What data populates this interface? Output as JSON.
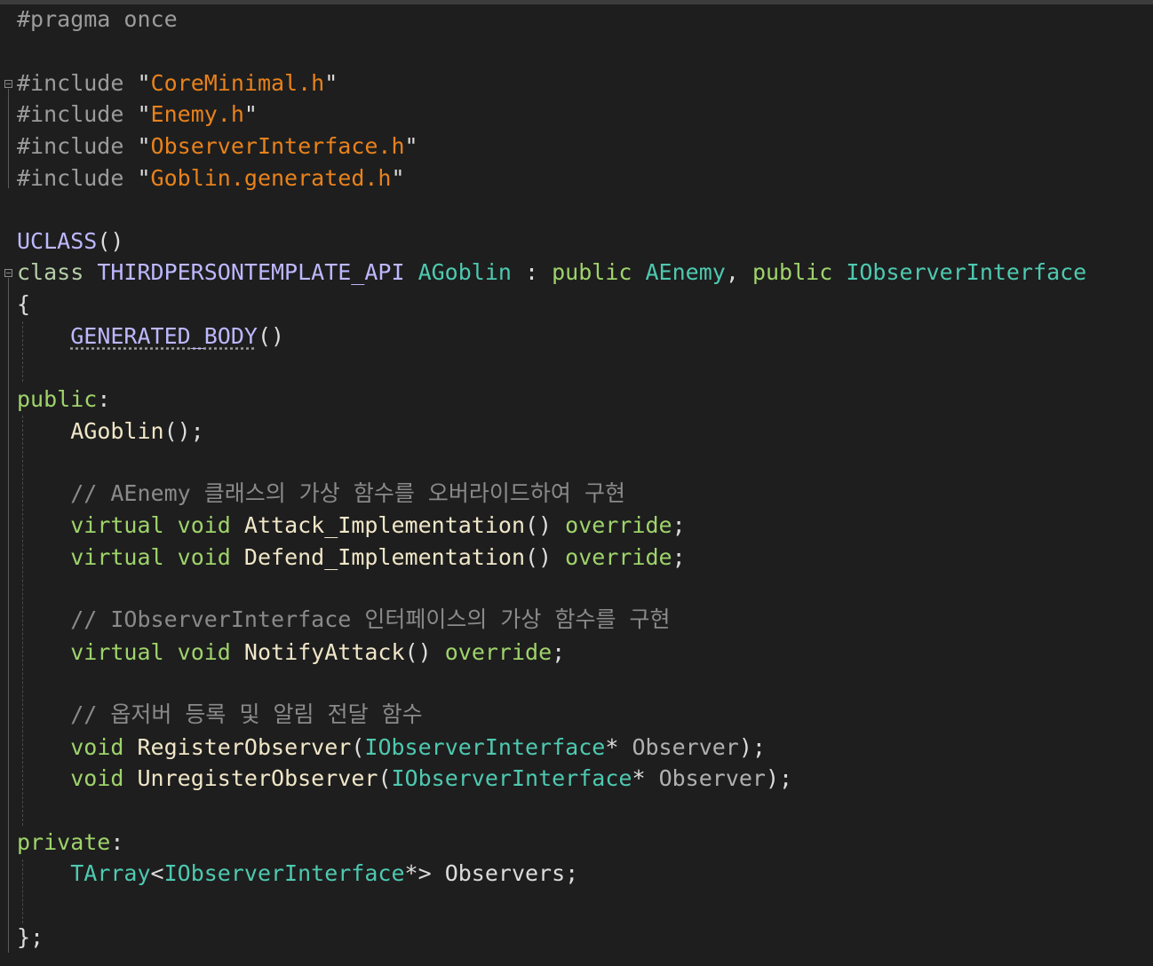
{
  "code": {
    "pragma": "#pragma",
    "pragma_arg": "once",
    "include_kw": "#include",
    "includes": [
      "CoreMinimal.h",
      "Enemy.h",
      "ObserverInterface.h",
      "Goblin.generated.h"
    ],
    "uclass": "UCLASS",
    "class_kw": "class",
    "api_macro": "THIRDPERSONTEMPLATE_API",
    "class_name": "AGoblin",
    "public_kw": "public",
    "base_1": "AEnemy",
    "base_2": "IObserverInterface",
    "generated_body": "GENERATED_BODY",
    "public_label": "public",
    "constructor": "AGoblin",
    "comment_1": "// AEnemy 클래스의 가상 함수를 오버라이드하여 구현",
    "virtual_kw": "virtual",
    "void_kw": "void",
    "override_kw": "override",
    "fn_attack": "Attack_Implementation",
    "fn_defend": "Defend_Implementation",
    "comment_2": "// IObserverInterface 인터페이스의 가상 함수를 구현",
    "fn_notify": "NotifyAttack",
    "comment_3": "// 옵저버 등록 및 알림 전달 함수",
    "fn_register": "RegisterObserver",
    "fn_unregister": "UnregisterObserver",
    "param_type": "IObserverInterface",
    "param_name": "Observer",
    "private_label": "private",
    "tarray": "TArray",
    "member_name": "Observers"
  },
  "colors": {
    "background": "#1e1e1e",
    "string": "#e8821c",
    "keyword": "#b5cea8",
    "type": "#4ec9b0",
    "macro": "#bdb8ff",
    "comment": "#8a8a8a"
  }
}
